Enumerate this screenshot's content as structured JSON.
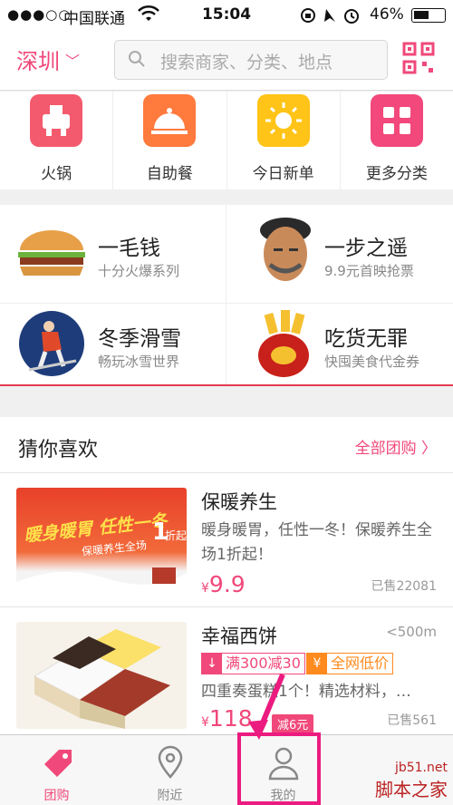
{
  "status_bar": {
    "signal": "●●●○○",
    "carrier": "中国联通",
    "time": "15:04",
    "battery": "46%"
  },
  "header": {
    "city": "深圳",
    "search_placeholder": "搜索商家、分类、地点"
  },
  "categories": [
    {
      "label": "火锅",
      "color": "#f45a6d",
      "icon": "hotpot-icon"
    },
    {
      "label": "自助餐",
      "color": "#ff7a3d",
      "icon": "buffet-icon"
    },
    {
      "label": "今日新单",
      "color": "#ffc417",
      "icon": "sun-icon"
    },
    {
      "label": "更多分类",
      "color": "#f2487b",
      "icon": "grid-icon"
    }
  ],
  "promos": [
    {
      "title": "一毛钱",
      "subtitle": "十分火爆系列",
      "icon": "burger-icon"
    },
    {
      "title": "一步之遥",
      "subtitle": "9.9元首映抢票",
      "icon": "movie-star-icon"
    },
    {
      "title": "冬季滑雪",
      "subtitle": "畅玩冰雪世界",
      "icon": "ski-icon"
    },
    {
      "title": "吃货无罪",
      "subtitle": "快囤美食代金券",
      "icon": "coupon-bag-icon"
    }
  ],
  "recommend": {
    "title": "猜你喜欢",
    "all_link": "全部团购",
    "deals": [
      {
        "name": "保暖养生",
        "desc": "暖身暖胃，任性一冬！保暖养生全场1折起！",
        "price_symbol": "¥",
        "price": "9.9",
        "sold": "已售22081",
        "image_text": "暖身暖胃 任性一冬",
        "image_sub": "保暖养生全场",
        "image_badge": "1",
        "image_badge_unit": "折起"
      },
      {
        "name": "幸福西饼",
        "distance": "<500m",
        "tag1_badge": "↓",
        "tag1": "满300减30",
        "tag2_badge": "¥",
        "tag2": "全网低价",
        "desc": "四重奏蛋糕1个！精选材料，…",
        "price_symbol": "¥",
        "price": "118",
        "discount": "减6元",
        "sold": "已售561"
      }
    ]
  },
  "tabs": [
    {
      "label": "团购",
      "active": true
    },
    {
      "label": "附近",
      "active": false
    },
    {
      "label": "我的",
      "active": false
    }
  ],
  "watermark": {
    "line1": "jb51.net",
    "line2": "脚本之家"
  },
  "colors": {
    "accent": "#f0487a",
    "highlight": "#ec1b80"
  }
}
